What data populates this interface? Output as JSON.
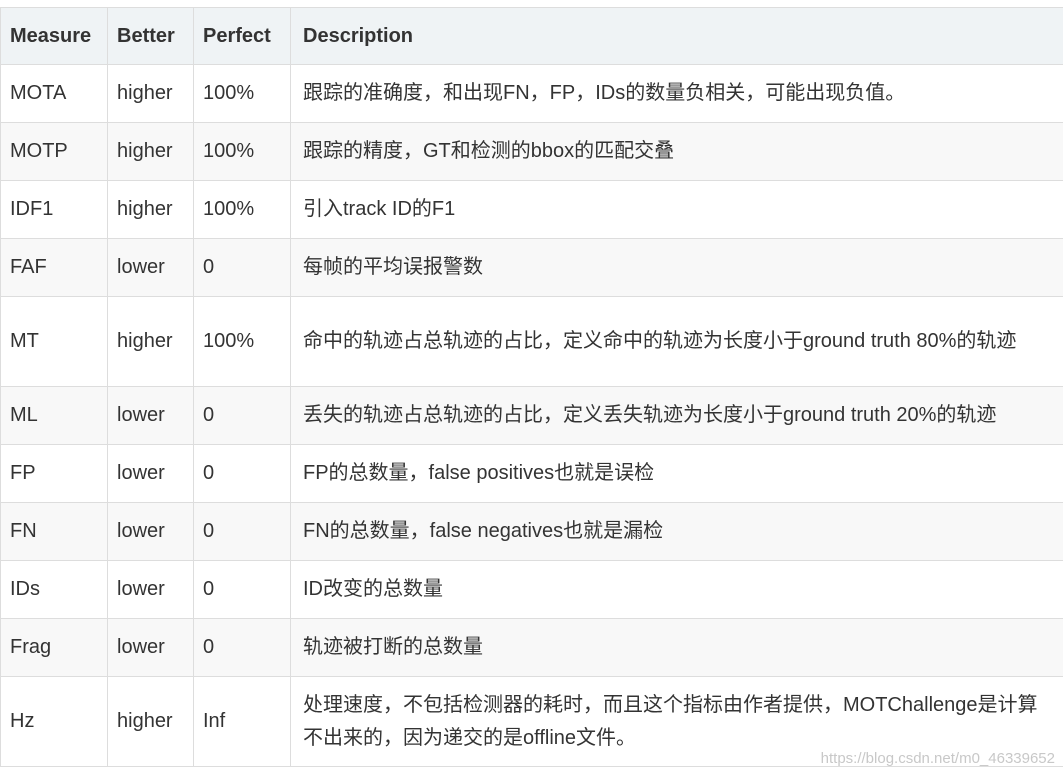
{
  "headers": {
    "measure": "Measure",
    "better": "Better",
    "perfect": "Perfect",
    "description": "Description"
  },
  "rows": [
    {
      "measure": "MOTA",
      "better": "higher",
      "perfect": "100%",
      "description": "跟踪的准确度，和出现FN，FP，IDs的数量负相关，可能出现负值。"
    },
    {
      "measure": "MOTP",
      "better": "higher",
      "perfect": "100%",
      "description": "跟踪的精度，GT和检测的bbox的匹配交叠"
    },
    {
      "measure": "IDF1",
      "better": "higher",
      "perfect": "100%",
      "description": "引入track ID的F1"
    },
    {
      "measure": "FAF",
      "better": "lower",
      "perfect": "0",
      "description": "每帧的平均误报警数"
    },
    {
      "measure": "MT",
      "better": "higher",
      "perfect": "100%",
      "description": "命中的轨迹占总轨迹的占比，定义命中的轨迹为长度小于ground truth 80%的轨迹"
    },
    {
      "measure": "ML",
      "better": "lower",
      "perfect": "0",
      "description": "丢失的轨迹占总轨迹的占比，定义丢失轨迹为长度小于ground truth 20%的轨迹"
    },
    {
      "measure": "FP",
      "better": "lower",
      "perfect": "0",
      "description": "FP的总数量，false positives也就是误检"
    },
    {
      "measure": "FN",
      "better": "lower",
      "perfect": "0",
      "description": "FN的总数量，false negatives也就是漏检"
    },
    {
      "measure": "IDs",
      "better": "lower",
      "perfect": "0",
      "description": "ID改变的总数量"
    },
    {
      "measure": "Frag",
      "better": "lower",
      "perfect": "0",
      "description": "轨迹被打断的总数量"
    },
    {
      "measure": "Hz",
      "better": "higher",
      "perfect": "Inf",
      "description": "处理速度，不包括检测器的耗时，而且这个指标由作者提供，MOTChallenge是计算不出来的，因为递交的是offline文件。"
    }
  ],
  "watermark": "https://blog.csdn.net/m0_46339652"
}
